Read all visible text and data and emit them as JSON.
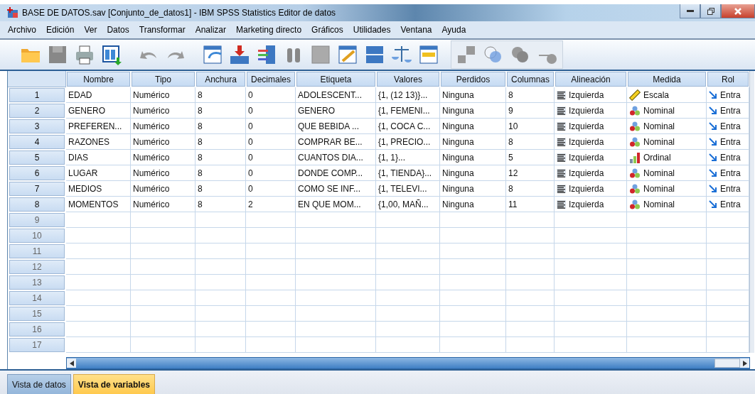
{
  "window": {
    "title": "BASE DE DATOS.sav [Conjunto_de_datos1] - IBM SPSS Statistics Editor de datos"
  },
  "menu": [
    "Archivo",
    "Edición",
    "Ver",
    "Datos",
    "Transformar",
    "Analizar",
    "Marketing directo",
    "Gráficos",
    "Utilidades",
    "Ventana",
    "Ayuda"
  ],
  "table": {
    "columns": [
      "Nombre",
      "Tipo",
      "Anchura",
      "Decimales",
      "Etiqueta",
      "Valores",
      "Perdidos",
      "Columnas",
      "Alineación",
      "Medida",
      "Rol"
    ],
    "rows": [
      {
        "number": "1",
        "nombre": "EDAD",
        "tipo": "Numérico",
        "anchura": "8",
        "decimales": "0",
        "etiqueta": "ADOLESCENT...",
        "valores": "{1, (12 13)}...",
        "perdidos": "Ninguna",
        "columnas": "8",
        "alineacion": "Izquierda",
        "medida": {
          "kind": "scale",
          "label": "Escala"
        },
        "rol": "Entra"
      },
      {
        "number": "2",
        "nombre": "GENERO",
        "tipo": "Numérico",
        "anchura": "8",
        "decimales": "0",
        "etiqueta": "GENERO",
        "valores": "{1, FEMENI...",
        "perdidos": "Ninguna",
        "columnas": "9",
        "alineacion": "Izquierda",
        "medida": {
          "kind": "nominal",
          "label": "Nominal"
        },
        "rol": "Entra"
      },
      {
        "number": "3",
        "nombre": "PREFEREN...",
        "tipo": "Numérico",
        "anchura": "8",
        "decimales": "0",
        "etiqueta": "QUE BEBIDA ...",
        "valores": "{1, COCA C...",
        "perdidos": "Ninguna",
        "columnas": "10",
        "alineacion": "Izquierda",
        "medida": {
          "kind": "nominal",
          "label": "Nominal"
        },
        "rol": "Entra"
      },
      {
        "number": "4",
        "nombre": "RAZONES",
        "tipo": "Numérico",
        "anchura": "8",
        "decimales": "0",
        "etiqueta": "COMPRAR BE...",
        "valores": "{1, PRECIO...",
        "perdidos": "Ninguna",
        "columnas": "8",
        "alineacion": "Izquierda",
        "medida": {
          "kind": "nominal",
          "label": "Nominal"
        },
        "rol": "Entra"
      },
      {
        "number": "5",
        "nombre": "DIAS",
        "tipo": "Numérico",
        "anchura": "8",
        "decimales": "0",
        "etiqueta": "CUANTOS DIA...",
        "valores": "{1, 1}...",
        "perdidos": "Ninguna",
        "columnas": "5",
        "alineacion": "Izquierda",
        "medida": {
          "kind": "ordinal",
          "label": "Ordinal"
        },
        "rol": "Entra"
      },
      {
        "number": "6",
        "nombre": "LUGAR",
        "tipo": "Numérico",
        "anchura": "8",
        "decimales": "0",
        "etiqueta": "DONDE COMP...",
        "valores": "{1, TIENDA}...",
        "perdidos": "Ninguna",
        "columnas": "12",
        "alineacion": "Izquierda",
        "medida": {
          "kind": "nominal",
          "label": "Nominal"
        },
        "rol": "Entra"
      },
      {
        "number": "7",
        "nombre": "MEDIOS",
        "tipo": "Numérico",
        "anchura": "8",
        "decimales": "0",
        "etiqueta": "COMO SE INF...",
        "valores": "{1, TELEVI...",
        "perdidos": "Ninguna",
        "columnas": "8",
        "alineacion": "Izquierda",
        "medida": {
          "kind": "nominal",
          "label": "Nominal"
        },
        "rol": "Entra"
      },
      {
        "number": "8",
        "nombre": "MOMENTOS",
        "tipo": "Numérico",
        "anchura": "8",
        "decimales": "2",
        "etiqueta": "EN QUE MOM...",
        "valores": "{1,00, MAÑ...",
        "perdidos": "Ninguna",
        "columnas": "11",
        "alineacion": "Izquierda",
        "medida": {
          "kind": "nominal",
          "label": "Nominal"
        },
        "rol": "Entra"
      },
      {
        "number": "9"
      },
      {
        "number": "10"
      },
      {
        "number": "11"
      },
      {
        "number": "12"
      },
      {
        "number": "13"
      },
      {
        "number": "14"
      },
      {
        "number": "15"
      },
      {
        "number": "16"
      },
      {
        "number": "17"
      }
    ]
  },
  "tabs": [
    {
      "label": "Vista de datos",
      "selected": false
    },
    {
      "label": "Vista de variables",
      "selected": true
    }
  ]
}
